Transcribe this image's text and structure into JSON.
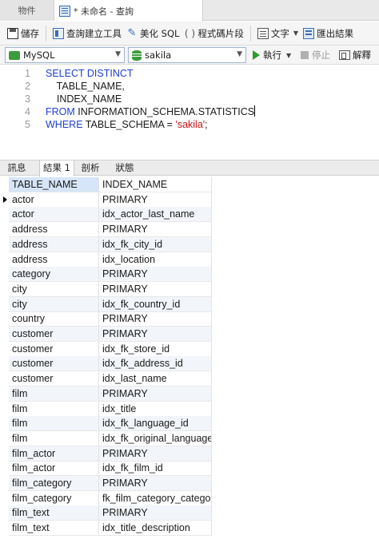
{
  "tabs": {
    "objects_label": "物件",
    "query_label": "* 未命名 - 查詢"
  },
  "toolbar": {
    "save_label": "儲存",
    "query_builder_label": "查詢建立工具",
    "beautify_sql_label": "美化 SQL",
    "code_snippet_label": "程式碼片段",
    "text_label": "文字",
    "export_results_label": "匯出結果"
  },
  "connection_bar": {
    "connection_value": "MySQL",
    "database_value": "sakila",
    "run_label": "執行",
    "stop_label": "停止",
    "explain_label": "解釋"
  },
  "editor": {
    "lines": [
      {
        "number": "1",
        "keyword": "SELECT DISTINCT",
        "text": "",
        "string": "",
        "tail": ""
      },
      {
        "number": "2",
        "keyword": "",
        "text": "    TABLE_NAME,",
        "string": "",
        "tail": ""
      },
      {
        "number": "3",
        "keyword": "",
        "text": "    INDEX_NAME",
        "string": "",
        "tail": ""
      },
      {
        "number": "4",
        "keyword": "FROM",
        "text": " INFORMATION_SCHEMA.STATISTICS",
        "string": "",
        "tail": ""
      },
      {
        "number": "5",
        "keyword": "WHERE",
        "text": " TABLE_SCHEMA = ",
        "string": "'sakila'",
        "tail": ";"
      }
    ]
  },
  "result_tabs": [
    "訊息",
    "結果 1",
    "剖析",
    "狀態"
  ],
  "active_result_tab": "結果 1",
  "grid": {
    "columns": [
      "TABLE_NAME",
      "INDEX_NAME"
    ],
    "rows": [
      [
        "actor",
        "PRIMARY"
      ],
      [
        "actor",
        "idx_actor_last_name"
      ],
      [
        "address",
        "PRIMARY"
      ],
      [
        "address",
        "idx_fk_city_id"
      ],
      [
        "address",
        "idx_location"
      ],
      [
        "category",
        "PRIMARY"
      ],
      [
        "city",
        "PRIMARY"
      ],
      [
        "city",
        "idx_fk_country_id"
      ],
      [
        "country",
        "PRIMARY"
      ],
      [
        "customer",
        "PRIMARY"
      ],
      [
        "customer",
        "idx_fk_store_id"
      ],
      [
        "customer",
        "idx_fk_address_id"
      ],
      [
        "customer",
        "idx_last_name"
      ],
      [
        "film",
        "PRIMARY"
      ],
      [
        "film",
        "idx_title"
      ],
      [
        "film",
        "idx_fk_language_id"
      ],
      [
        "film",
        "idx_fk_original_language_i"
      ],
      [
        "film_actor",
        "PRIMARY"
      ],
      [
        "film_actor",
        "idx_fk_film_id"
      ],
      [
        "film_category",
        "PRIMARY"
      ],
      [
        "film_category",
        "fk_film_category_category"
      ],
      [
        "film_text",
        "PRIMARY"
      ],
      [
        "film_text",
        "idx_title_description"
      ]
    ]
  },
  "colors": {
    "keyword": "#1f3fcf",
    "string": "#c71515",
    "run_icon": "#2e9c2e"
  }
}
